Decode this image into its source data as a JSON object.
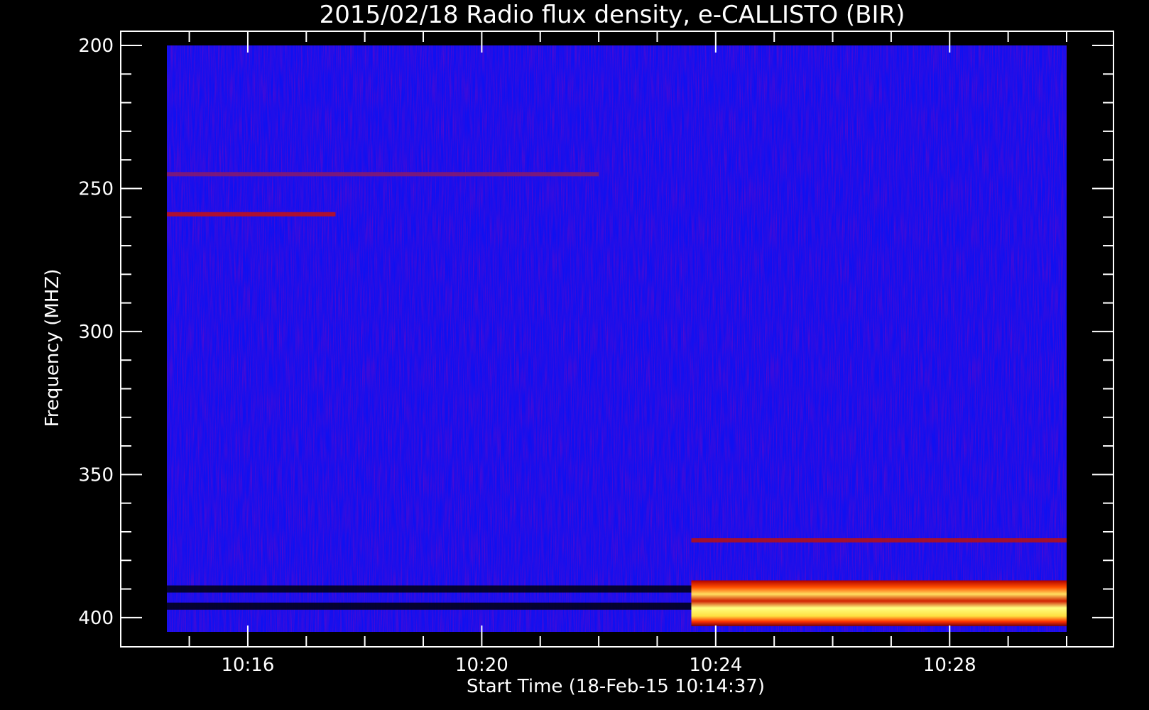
{
  "chart_data": {
    "type": "heatmap",
    "title": "2015/02/18  Radio flux density, e-CALLISTO (BIR)",
    "xlabel": "Start Time (18-Feb-15 10:14:37)",
    "ylabel": "Frequency (MHZ)",
    "x_range": [
      "10:14:37",
      "10:30:00"
    ],
    "y_range": [
      200,
      405
    ],
    "y_inverted": true,
    "x_ticks": [
      "10:16",
      "10:20",
      "10:24",
      "10:28"
    ],
    "y_ticks": [
      200,
      250,
      300,
      350,
      400
    ],
    "colormap": [
      "#0000ff",
      "#9b0000",
      "#ff3000",
      "#ffff66"
    ],
    "background_color": "#1010f0",
    "features": [
      {
        "kind": "band",
        "freq": 245,
        "start": "10:14:37",
        "end": "10:22:00",
        "color": "#8a1a6a"
      },
      {
        "kind": "band",
        "freq": 259,
        "start": "10:14:37",
        "end": "10:17:30",
        "color": "#c81010"
      },
      {
        "kind": "band",
        "freq": 373,
        "start": "10:23:35",
        "end": "10:30:00",
        "color": "#b81010"
      },
      {
        "kind": "dark-band",
        "freq": 390,
        "start": "10:14:37",
        "end": "10:23:35"
      },
      {
        "kind": "dark-band",
        "freq": 396,
        "start": "10:14:37",
        "end": "10:23:35"
      },
      {
        "kind": "intense-emission",
        "freq_range": [
          387,
          403
        ],
        "start": "10:23:35",
        "end": "10:30:00",
        "peak_freq": 396
      }
    ]
  }
}
